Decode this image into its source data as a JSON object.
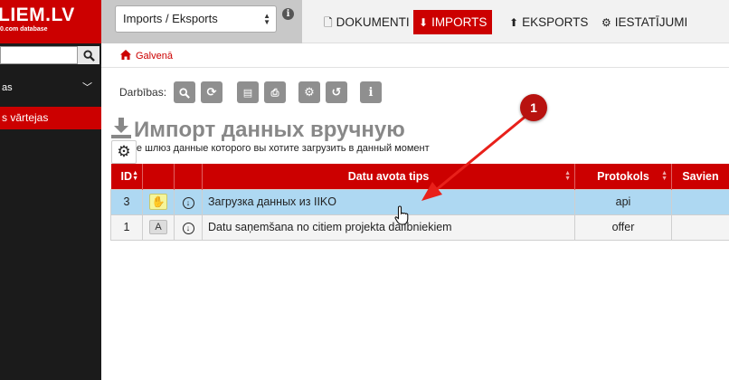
{
  "logo": {
    "brand": "LIEM.LV",
    "sub": "0.com database"
  },
  "source_select": {
    "value": "Imports / Eksports"
  },
  "nav": {
    "items": [
      {
        "label": "DOKUMENTI",
        "icon": "file-icon",
        "active": false
      },
      {
        "label": "IMPORTS",
        "icon": "download-icon",
        "active": true
      },
      {
        "label": "EKSPORTS",
        "icon": "upload-icon",
        "active": false
      },
      {
        "label": "IESTATĪJUMI",
        "icon": "gears-icon",
        "active": false
      }
    ]
  },
  "sidebar": {
    "group_label": "as",
    "active_item": "s vārtejas"
  },
  "breadcrumb": {
    "home": "Galvenā"
  },
  "toolbar": {
    "label": "Darbības:",
    "buttons": [
      "search-icon",
      "refresh-icon",
      "excel-icon",
      "print-icon",
      "settings-icon",
      "history-icon",
      "info-icon"
    ]
  },
  "heading": {
    "title": "Импорт данных вручную",
    "subtitle": "те шлюз данные которого вы хотите загрузить в данный момент"
  },
  "table": {
    "columns": [
      "ID",
      "",
      "",
      "Datu avota tips",
      "Protokols",
      "Savien"
    ],
    "rows": [
      {
        "id": "3",
        "badge": "hand",
        "name": "Загрузка данных из IIKO",
        "protocol": "api",
        "selected": true
      },
      {
        "id": "1",
        "badge": "A",
        "name": "Datu saņemšana no citiem projekta dalībniekiem",
        "protocol": "offer",
        "selected": false
      }
    ]
  },
  "annotation": {
    "number": "1"
  },
  "colors": {
    "brand": "#cc0000",
    "selected_row": "#aed8f2",
    "sidebar": "#1b1b1b",
    "arrow": "#e8201a"
  }
}
